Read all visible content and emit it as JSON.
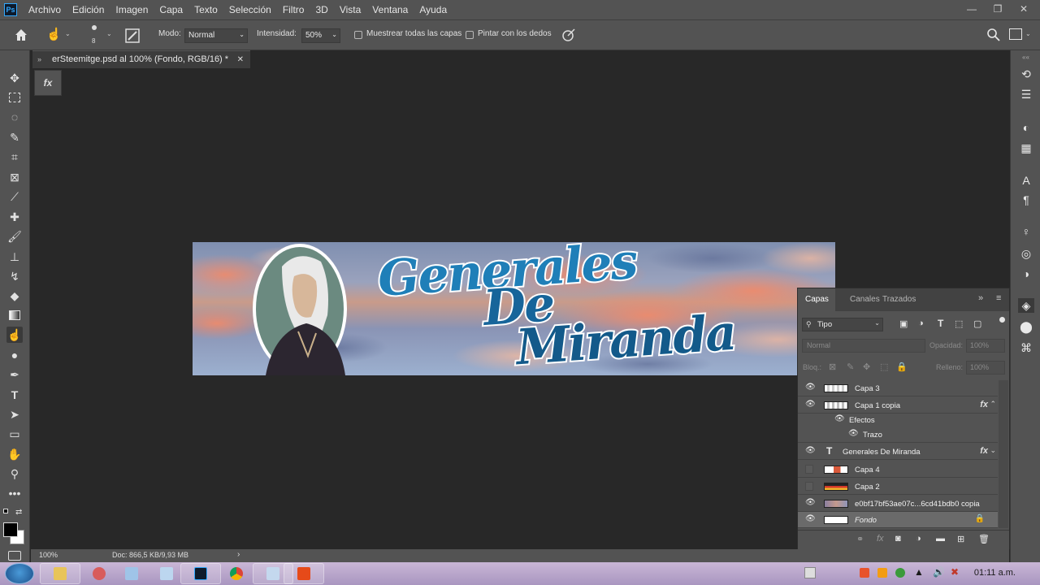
{
  "menu": {
    "items": [
      "Archivo",
      "Edición",
      "Imagen",
      "Capa",
      "Texto",
      "Selección",
      "Filtro",
      "3D",
      "Vista",
      "Ventana",
      "Ayuda"
    ]
  },
  "options": {
    "brush_size": "8",
    "mode_label": "Modo:",
    "mode_value": "Normal",
    "intensity_label": "Intensidad:",
    "intensity_value": "50%",
    "sample_all_label": "Muestrear todas las capas",
    "finger_paint_label": "Pintar con los dedos"
  },
  "document": {
    "tab_title": "erSteemitge.psd al 100% (Fondo, RGB/16) *"
  },
  "canvas": {
    "title_line1": "Generales",
    "title_line2": "De",
    "title_line3": "Miranda"
  },
  "status": {
    "zoom": "100%",
    "doc_info": "Doc: 866,5 KB/9,93 MB"
  },
  "layers_panel": {
    "tabs": [
      "Capas",
      "Canales",
      "Trazados"
    ],
    "filter_label": "Tipo",
    "blend_mode": "Normal",
    "opacity_label": "Opacidad:",
    "opacity_value": "100%",
    "lock_label": "Bloq.:",
    "fill_label": "Relleno:",
    "fill_value": "100%",
    "layers": [
      {
        "name": "Capa 3",
        "visible": true
      },
      {
        "name": "Capa 1 copia",
        "visible": true,
        "fx": true
      },
      {
        "name": "Efectos",
        "visible": true
      },
      {
        "name": "Trazo",
        "visible": true
      },
      {
        "name": "Generales        De        Miranda",
        "visible": true,
        "fx": true
      },
      {
        "name": "Capa 4",
        "visible": false
      },
      {
        "name": "Capa 2",
        "visible": false
      },
      {
        "name": "e0bf17bf53ae07c...6cd41bdb0 copia",
        "visible": true
      },
      {
        "name": "Fondo",
        "visible": true,
        "locked": true
      }
    ]
  },
  "taskbar": {
    "clock": "01:11 a.m."
  },
  "colors": {
    "ui_bg": "#535353",
    "canvas_bg": "#282828",
    "accent": "#31a8ff",
    "title_blue": "#1f7fb8"
  }
}
